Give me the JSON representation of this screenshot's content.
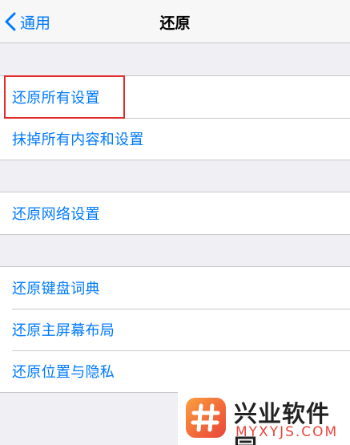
{
  "nav": {
    "back_label": "通用",
    "title": "还原"
  },
  "groups": [
    {
      "items": [
        "还原所有设置",
        "抹掉所有内容和设置"
      ]
    },
    {
      "items": [
        "还原网络设置"
      ]
    },
    {
      "items": [
        "还原键盘词典",
        "还原主屏幕布局",
        "还原位置与隐私"
      ]
    }
  ],
  "highlighted_item": "还原所有设置",
  "colors": {
    "accent": "#007aff",
    "background": "#efeff4",
    "separator": "#c8c7cc",
    "highlight_box": "#e22c2c"
  },
  "watermark": {
    "name": "兴业软件园",
    "url": "MYXYJS.COM",
    "logo": "hash-logo-icon"
  }
}
